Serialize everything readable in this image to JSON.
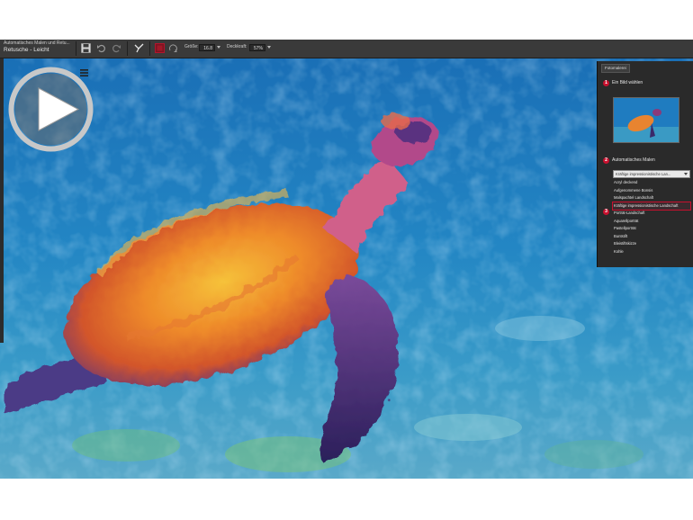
{
  "window": {
    "title_line1": "Automatisches Malen und Retu...",
    "title_line2": "Retusche - Leicht"
  },
  "toolbar": {
    "size_label": "Größe:",
    "size_value": "16.8",
    "opacity_label": "Deckkraft:",
    "opacity_value": "57%"
  },
  "panel": {
    "tab_label": "Fotomalerei",
    "steps": [
      {
        "number": "1",
        "label": "Ein Bild wählen"
      },
      {
        "number": "2",
        "label": "Automatisches Malen"
      },
      {
        "number": "3",
        "label": ""
      }
    ],
    "selected_style": "Kräftige impressionistische Lan...",
    "styles": [
      "Acryl deckend",
      "Aufgenommene Bonsis",
      "Malspachtel Landschaft",
      "Kräftige impressionistische Landschaft",
      "Porträt-Landschaft",
      "Aquarellporträt",
      "Pastellporträt",
      "Buntstift",
      "Bleistiftskizze",
      "Kohle"
    ],
    "highlighted_index": 3
  },
  "colors": {
    "accent": "#c8102e",
    "toolbar_bg": "#3a3a3a",
    "panel_bg": "#2a2a2a",
    "water": "#1d74b8"
  },
  "icons": [
    "save-icon",
    "undo-icon",
    "redo-icon",
    "brush-icon",
    "color-swatch-icon",
    "rotate-icon",
    "play-icon",
    "menu-icon"
  ]
}
